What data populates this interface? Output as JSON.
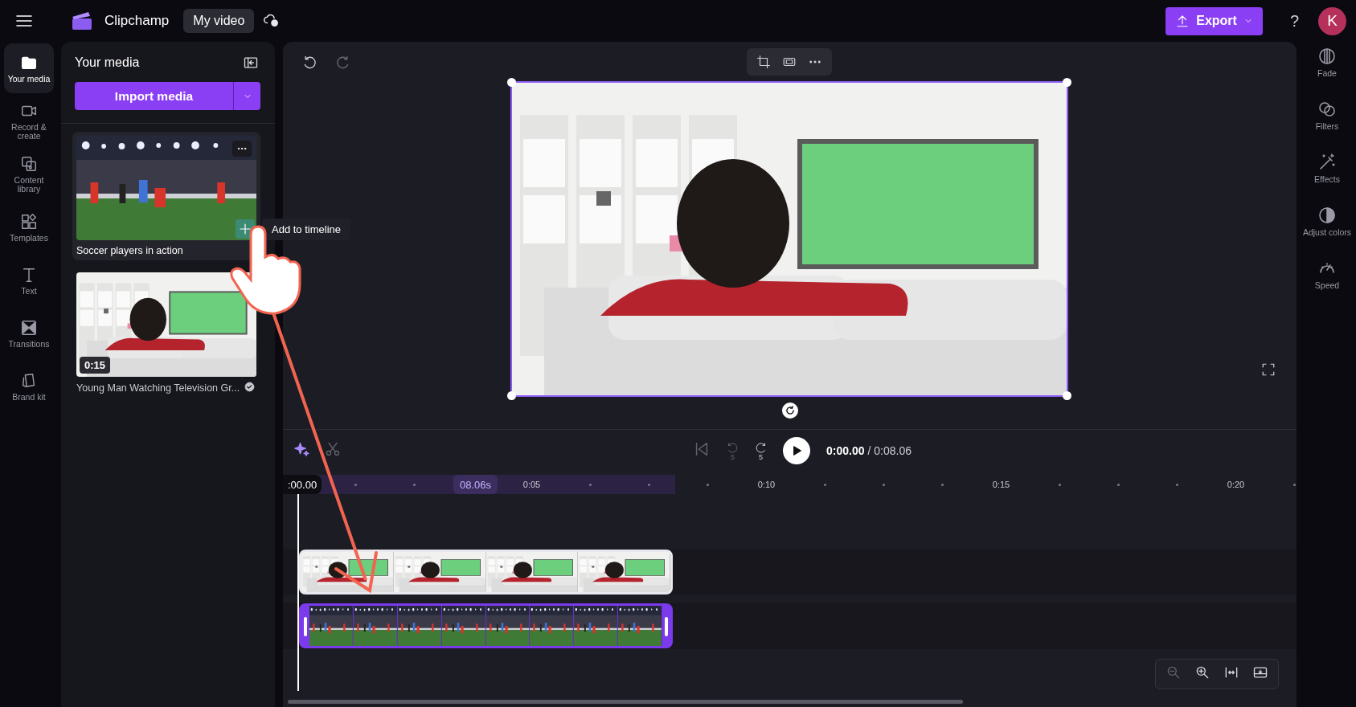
{
  "topbar": {
    "brand": "Clipchamp",
    "project_title": "My video",
    "export_label": "Export",
    "help_label": "?",
    "avatar_initial": "K"
  },
  "nav": [
    {
      "label": "Your media",
      "selected": true
    },
    {
      "label": "Record & create",
      "selected": false
    },
    {
      "label": "Content library",
      "selected": false
    },
    {
      "label": "Templates",
      "selected": false
    },
    {
      "label": "Text",
      "selected": false
    },
    {
      "label": "Transitions",
      "selected": false
    },
    {
      "label": "Brand kit",
      "selected": false
    }
  ],
  "media_panel": {
    "title": "Your media",
    "import_label": "Import media",
    "items": [
      {
        "kind": "soccer",
        "title": "Soccer players in action",
        "hovered": true,
        "verified": false
      },
      {
        "kind": "room",
        "title": "Young Man Watching Television Gr...",
        "duration": "0:15",
        "hovered": false,
        "verified": true
      }
    ]
  },
  "tooltip": "Add to timeline",
  "playback": {
    "back_seconds": "5",
    "forward_seconds": "5",
    "current_time": "0:00.00",
    "total_time": "/ 0:08.06"
  },
  "ruler": {
    "playhead_time": ":00.00",
    "selection_length": "08.06s",
    "labels": [
      "0:05",
      "0:10",
      "0:15",
      "0:20"
    ]
  },
  "tracks": [
    {
      "kind": "room",
      "selected": false
    },
    {
      "kind": "soccer",
      "selected": true
    }
  ],
  "properties": [
    {
      "label": "Fade"
    },
    {
      "label": "Filters"
    },
    {
      "label": "Effects"
    },
    {
      "label": "Adjust colors"
    },
    {
      "label": "Speed"
    }
  ]
}
